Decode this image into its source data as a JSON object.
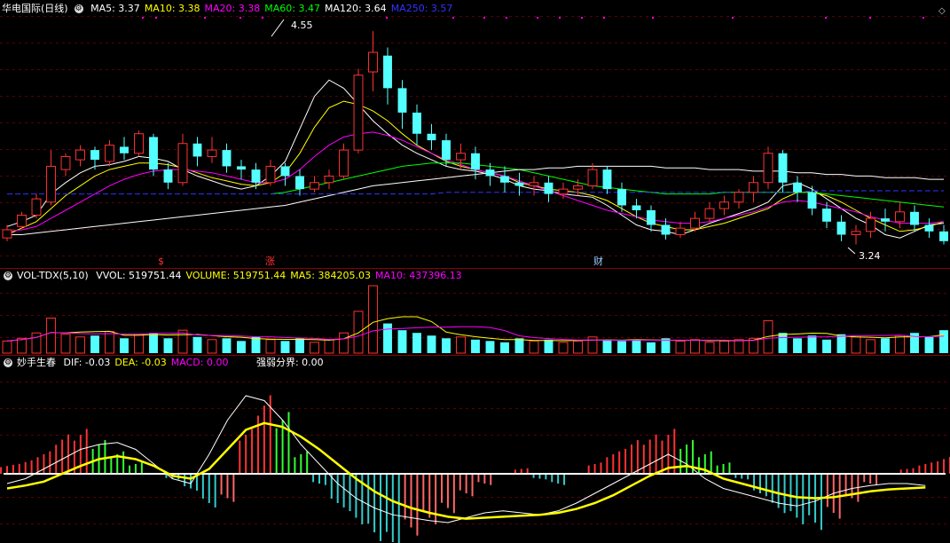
{
  "header": {
    "stock_title": "华电国际(日线)",
    "ma_labels": [
      {
        "text": "MA5: 3.37",
        "color": "#ffffff"
      },
      {
        "text": "MA10: 3.38",
        "color": "#ffff00"
      },
      {
        "text": "MA20: 3.38",
        "color": "#ff00ff"
      },
      {
        "text": "MA60: 3.47",
        "color": "#00ff00"
      },
      {
        "text": "MA120: 3.64",
        "color": "#ffffff"
      },
      {
        "text": "MA250: 3.57",
        "color": "#3333ff"
      }
    ]
  },
  "volume_panel": {
    "indicator_name": "VOL-TDX(5,10)",
    "labels": [
      {
        "text": "VVOL: 519751.44",
        "color": "#ffffff"
      },
      {
        "text": "VOLUME: 519751.44",
        "color": "#ffff00"
      },
      {
        "text": "MA5: 384205.03",
        "color": "#ffff00"
      },
      {
        "text": "MA10: 437396.13",
        "color": "#ff00ff"
      }
    ]
  },
  "macd_panel": {
    "indicator_name": "妙手生春",
    "labels": [
      {
        "text": "DIF: -0.03",
        "color": "#ffffff"
      },
      {
        "text": "DEA: -0.03",
        "color": "#ffff00"
      },
      {
        "text": "MACD: 0.00",
        "color": "#ff00ff"
      }
    ],
    "extra_label": "强弱分界: 0.00"
  },
  "chart_data": {
    "type": "candlestick",
    "price_annotations": {
      "high": "4.55",
      "low": "3.24"
    },
    "event_markers": [
      "$",
      "涨",
      "财"
    ],
    "colors": {
      "up": "#ff3232",
      "down": "#54ffff",
      "grid": "#8b0000"
    },
    "series": [
      {
        "name": "MA5",
        "values": [
          3.35,
          3.38,
          3.42,
          3.55,
          3.62,
          3.68,
          3.72,
          3.73,
          3.75,
          3.78,
          3.77,
          3.75,
          3.7,
          3.66,
          3.63,
          3.6,
          3.58,
          3.6,
          3.66,
          3.75,
          3.95,
          4.15,
          4.25,
          4.2,
          4.1,
          4.0,
          3.92,
          3.85,
          3.8,
          3.76,
          3.72,
          3.7,
          3.69,
          3.67,
          3.64,
          3.6,
          3.58,
          3.57,
          3.55,
          3.54,
          3.53,
          3.48,
          3.42,
          3.36,
          3.33,
          3.32,
          3.3,
          3.33,
          3.37,
          3.4,
          3.43,
          3.46,
          3.5,
          3.6,
          3.62,
          3.58,
          3.52,
          3.46,
          3.4,
          3.36,
          3.3,
          3.28,
          3.32,
          3.36,
          3.37
        ]
      },
      {
        "name": "MA10",
        "values": [
          3.3,
          3.34,
          3.38,
          3.46,
          3.54,
          3.6,
          3.66,
          3.7,
          3.72,
          3.74,
          3.74,
          3.73,
          3.71,
          3.68,
          3.65,
          3.63,
          3.61,
          3.6,
          3.62,
          3.68,
          3.8,
          3.96,
          4.08,
          4.12,
          4.1,
          4.06,
          4.0,
          3.92,
          3.85,
          3.8,
          3.75,
          3.72,
          3.7,
          3.68,
          3.66,
          3.62,
          3.6,
          3.58,
          3.57,
          3.56,
          3.54,
          3.51,
          3.46,
          3.41,
          3.37,
          3.35,
          3.33,
          3.33,
          3.35,
          3.37,
          3.4,
          3.43,
          3.46,
          3.52,
          3.56,
          3.56,
          3.54,
          3.5,
          3.45,
          3.4,
          3.36,
          3.32,
          3.33,
          3.35,
          3.38
        ]
      },
      {
        "name": "MA20",
        "values": [
          3.32,
          3.33,
          3.35,
          3.4,
          3.45,
          3.5,
          3.55,
          3.6,
          3.64,
          3.67,
          3.69,
          3.7,
          3.7,
          3.69,
          3.68,
          3.66,
          3.64,
          3.62,
          3.62,
          3.64,
          3.7,
          3.78,
          3.85,
          3.9,
          3.92,
          3.93,
          3.91,
          3.88,
          3.84,
          3.8,
          3.76,
          3.73,
          3.7,
          3.68,
          3.66,
          3.63,
          3.6,
          3.57,
          3.54,
          3.51,
          3.48,
          3.45,
          3.43,
          3.41,
          3.39,
          3.38,
          3.37,
          3.37,
          3.38,
          3.4,
          3.42,
          3.44,
          3.47,
          3.5,
          3.51,
          3.5,
          3.48,
          3.46,
          3.44,
          3.41,
          3.39,
          3.37,
          3.37,
          3.37,
          3.38
        ]
      },
      {
        "name": "MA60",
        "values": [
          null,
          null,
          null,
          null,
          null,
          null,
          null,
          null,
          null,
          null,
          null,
          null,
          null,
          null,
          null,
          null,
          null,
          null,
          3.55,
          3.56,
          3.58,
          3.6,
          3.62,
          3.64,
          3.66,
          3.68,
          3.7,
          3.72,
          3.73,
          3.74,
          3.74,
          3.74,
          3.73,
          3.72,
          3.71,
          3.7,
          3.68,
          3.66,
          3.64,
          3.62,
          3.6,
          3.59,
          3.58,
          3.57,
          3.56,
          3.55,
          3.55,
          3.55,
          3.55,
          3.56,
          3.56,
          3.56,
          3.56,
          3.56,
          3.56,
          3.56,
          3.55,
          3.54,
          3.53,
          3.52,
          3.51,
          3.5,
          3.49,
          3.48,
          3.47
        ]
      },
      {
        "name": "MA120",
        "values": [
          3.3,
          3.3,
          3.31,
          3.32,
          3.33,
          3.34,
          3.35,
          3.36,
          3.37,
          3.38,
          3.39,
          3.4,
          3.41,
          3.42,
          3.43,
          3.44,
          3.45,
          3.46,
          3.47,
          3.48,
          3.5,
          3.52,
          3.54,
          3.56,
          3.58,
          3.6,
          3.61,
          3.62,
          3.63,
          3.64,
          3.65,
          3.66,
          3.67,
          3.68,
          3.69,
          3.7,
          3.7,
          3.71,
          3.71,
          3.72,
          3.72,
          3.72,
          3.72,
          3.72,
          3.72,
          3.71,
          3.71,
          3.71,
          3.7,
          3.7,
          3.7,
          3.69,
          3.69,
          3.69,
          3.68,
          3.68,
          3.67,
          3.67,
          3.66,
          3.66,
          3.65,
          3.65,
          3.65,
          3.64,
          3.64
        ]
      },
      {
        "name": "MA250",
        "values": [
          3.55,
          3.55,
          3.55,
          3.55,
          3.55,
          3.55,
          3.55,
          3.55,
          3.55,
          3.55,
          3.55,
          3.55,
          3.55,
          3.55,
          3.55,
          3.55,
          3.55,
          3.55,
          3.55,
          3.55,
          3.55,
          3.55,
          3.55,
          3.55,
          3.55,
          3.55,
          3.55,
          3.55,
          3.55,
          3.55,
          3.56,
          3.56,
          3.56,
          3.56,
          3.56,
          3.56,
          3.56,
          3.56,
          3.56,
          3.56,
          3.56,
          3.56,
          3.56,
          3.56,
          3.56,
          3.56,
          3.56,
          3.56,
          3.56,
          3.56,
          3.56,
          3.56,
          3.56,
          3.56,
          3.56,
          3.57,
          3.57,
          3.57,
          3.57,
          3.57,
          3.57,
          3.57,
          3.57,
          3.57,
          3.57
        ]
      }
    ],
    "candles": [
      [
        3.28,
        3.33,
        3.26,
        3.36
      ],
      [
        3.35,
        3.42,
        3.34,
        3.44
      ],
      [
        3.42,
        3.52,
        3.4,
        3.55
      ],
      [
        3.5,
        3.72,
        3.48,
        3.82
      ],
      [
        3.7,
        3.78,
        3.66,
        3.8
      ],
      [
        3.76,
        3.82,
        3.72,
        3.85
      ],
      [
        3.82,
        3.76,
        3.7,
        3.84
      ],
      [
        3.75,
        3.85,
        3.72,
        3.88
      ],
      [
        3.84,
        3.8,
        3.76,
        3.9
      ],
      [
        3.8,
        3.92,
        3.78,
        3.94
      ],
      [
        3.9,
        3.7,
        3.66,
        3.92
      ],
      [
        3.7,
        3.62,
        3.58,
        3.74
      ],
      [
        3.62,
        3.86,
        3.6,
        3.92
      ],
      [
        3.86,
        3.78,
        3.72,
        3.9
      ],
      [
        3.78,
        3.82,
        3.74,
        3.9
      ],
      [
        3.82,
        3.72,
        3.68,
        3.86
      ],
      [
        3.72,
        3.7,
        3.64,
        3.76
      ],
      [
        3.7,
        3.62,
        3.58,
        3.74
      ],
      [
        3.62,
        3.72,
        3.6,
        3.76
      ],
      [
        3.72,
        3.66,
        3.6,
        3.74
      ],
      [
        3.66,
        3.58,
        3.54,
        3.7
      ],
      [
        3.58,
        3.62,
        3.56,
        3.66
      ],
      [
        3.62,
        3.66,
        3.58,
        3.7
      ],
      [
        3.66,
        3.82,
        3.64,
        3.86
      ],
      [
        3.82,
        4.28,
        3.8,
        4.32
      ],
      [
        4.3,
        4.42,
        4.18,
        4.55
      ],
      [
        4.4,
        4.2,
        4.1,
        4.45
      ],
      [
        4.2,
        4.05,
        3.95,
        4.25
      ],
      [
        4.05,
        3.92,
        3.85,
        4.1
      ],
      [
        3.92,
        3.88,
        3.82,
        3.98
      ],
      [
        3.88,
        3.76,
        3.72,
        3.92
      ],
      [
        3.76,
        3.8,
        3.7,
        3.86
      ],
      [
        3.8,
        3.7,
        3.64,
        3.84
      ],
      [
        3.7,
        3.66,
        3.6,
        3.74
      ],
      [
        3.66,
        3.62,
        3.56,
        3.72
      ],
      [
        3.62,
        3.6,
        3.54,
        3.68
      ],
      [
        3.6,
        3.62,
        3.54,
        3.66
      ],
      [
        3.62,
        3.55,
        3.5,
        3.66
      ],
      [
        3.55,
        3.58,
        3.52,
        3.62
      ],
      [
        3.58,
        3.6,
        3.54,
        3.64
      ],
      [
        3.6,
        3.7,
        3.58,
        3.74
      ],
      [
        3.7,
        3.58,
        3.55,
        3.72
      ],
      [
        3.58,
        3.48,
        3.44,
        3.62
      ],
      [
        3.48,
        3.45,
        3.4,
        3.52
      ],
      [
        3.45,
        3.36,
        3.32,
        3.48
      ],
      [
        3.36,
        3.3,
        3.27,
        3.4
      ],
      [
        3.3,
        3.34,
        3.28,
        3.38
      ],
      [
        3.34,
        3.4,
        3.32,
        3.44
      ],
      [
        3.4,
        3.46,
        3.38,
        3.5
      ],
      [
        3.46,
        3.5,
        3.42,
        3.54
      ],
      [
        3.5,
        3.56,
        3.46,
        3.58
      ],
      [
        3.56,
        3.62,
        3.5,
        3.66
      ],
      [
        3.62,
        3.8,
        3.58,
        3.84
      ],
      [
        3.8,
        3.62,
        3.56,
        3.82
      ],
      [
        3.62,
        3.56,
        3.5,
        3.66
      ],
      [
        3.56,
        3.46,
        3.42,
        3.6
      ],
      [
        3.46,
        3.38,
        3.34,
        3.5
      ],
      [
        3.38,
        3.3,
        3.26,
        3.42
      ],
      [
        3.3,
        3.32,
        3.24,
        3.36
      ],
      [
        3.32,
        3.4,
        3.28,
        3.44
      ],
      [
        3.4,
        3.38,
        3.32,
        3.46
      ],
      [
        3.38,
        3.44,
        3.34,
        3.5
      ],
      [
        3.44,
        3.36,
        3.32,
        3.48
      ],
      [
        3.36,
        3.32,
        3.28,
        3.4
      ],
      [
        3.32,
        3.26,
        3.24,
        3.36
      ]
    ],
    "volume": [
      0.18,
      0.22,
      0.3,
      0.52,
      0.28,
      0.24,
      0.26,
      0.32,
      0.22,
      0.28,
      0.3,
      0.22,
      0.34,
      0.24,
      0.2,
      0.22,
      0.18,
      0.24,
      0.2,
      0.18,
      0.22,
      0.16,
      0.2,
      0.3,
      0.62,
      1.0,
      0.44,
      0.34,
      0.3,
      0.26,
      0.22,
      0.24,
      0.2,
      0.18,
      0.16,
      0.22,
      0.18,
      0.2,
      0.16,
      0.18,
      0.24,
      0.2,
      0.18,
      0.2,
      0.16,
      0.22,
      0.18,
      0.2,
      0.16,
      0.18,
      0.2,
      0.22,
      0.48,
      0.3,
      0.22,
      0.26,
      0.2,
      0.28,
      0.24,
      0.2,
      0.22,
      0.26,
      0.3,
      0.24,
      0.34
    ],
    "macd_bars": [
      0.08,
      0.12,
      0.2,
      0.35,
      0.4,
      0.3,
      0.2,
      0.1,
      0.0,
      -0.05,
      -0.15,
      -0.3,
      -0.25,
      0.4,
      0.7,
      0.55,
      0.2,
      -0.1,
      -0.3,
      -0.45,
      -0.6,
      -0.7,
      -0.55,
      -0.45,
      -0.35,
      -0.2,
      -0.1,
      0.0,
      0.05,
      -0.05,
      -0.1,
      0.0,
      0.1,
      0.2,
      0.3,
      0.35,
      0.4,
      0.3,
      0.2,
      0.1,
      -0.05,
      -0.2,
      -0.35,
      -0.45,
      -0.5,
      -0.4,
      -0.25,
      -0.1,
      0.0,
      0.05,
      0.1,
      0.15
    ],
    "dif": [
      -0.1,
      -0.05,
      0.05,
      0.15,
      0.25,
      0.3,
      0.32,
      0.25,
      0.1,
      -0.05,
      -0.1,
      0.2,
      0.55,
      0.8,
      0.75,
      0.55,
      0.3,
      0.1,
      -0.1,
      -0.25,
      -0.35,
      -0.42,
      -0.45,
      -0.48,
      -0.5,
      -0.45,
      -0.4,
      -0.38,
      -0.4,
      -0.42,
      -0.38,
      -0.3,
      -0.2,
      -0.1,
      0.0,
      0.1,
      0.2,
      0.1,
      -0.05,
      -0.15,
      -0.2,
      -0.25,
      -0.3,
      -0.33,
      -0.28,
      -0.2,
      -0.15,
      -0.12,
      -0.1,
      -0.1,
      -0.12
    ],
    "dea": [
      -0.15,
      -0.12,
      -0.08,
      0.0,
      0.08,
      0.15,
      0.18,
      0.15,
      0.08,
      -0.02,
      -0.05,
      0.05,
      0.25,
      0.45,
      0.52,
      0.48,
      0.38,
      0.25,
      0.1,
      -0.05,
      -0.18,
      -0.28,
      -0.35,
      -0.4,
      -0.44,
      -0.46,
      -0.45,
      -0.44,
      -0.43,
      -0.42,
      -0.4,
      -0.36,
      -0.3,
      -0.22,
      -0.12,
      -0.02,
      0.06,
      0.08,
      0.04,
      -0.05,
      -0.1,
      -0.15,
      -0.2,
      -0.24,
      -0.25,
      -0.24,
      -0.21,
      -0.18,
      -0.16,
      -0.15,
      -0.14
    ]
  }
}
